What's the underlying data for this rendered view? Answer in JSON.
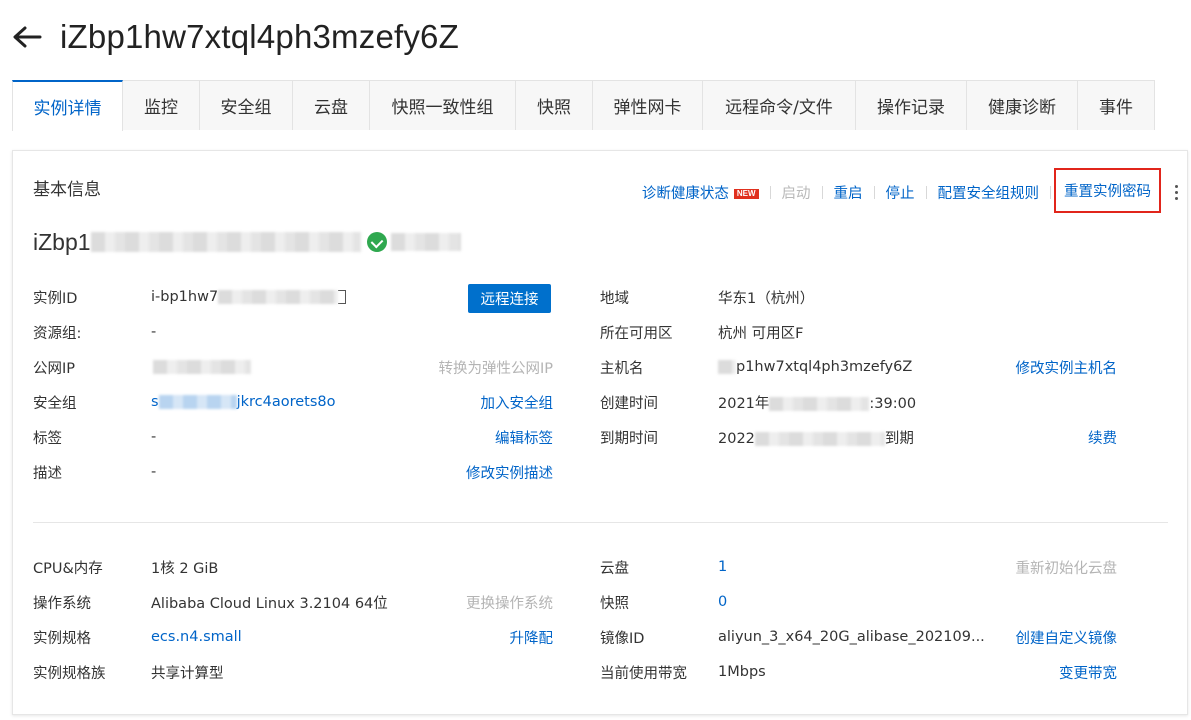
{
  "header": {
    "back_icon": "arrow-left-icon",
    "title": "iZbp1hw7xtql4ph3mzefy6Z"
  },
  "tabs": [
    {
      "label": "实例详情",
      "active": true
    },
    {
      "label": "监控"
    },
    {
      "label": "安全组"
    },
    {
      "label": "云盘"
    },
    {
      "label": "快照一致性组"
    },
    {
      "label": "快照"
    },
    {
      "label": "弹性网卡"
    },
    {
      "label": "远程命令/文件"
    },
    {
      "label": "操作记录"
    },
    {
      "label": "健康诊断"
    },
    {
      "label": "事件"
    }
  ],
  "basic": {
    "section_title": "基本信息",
    "actions": {
      "diagnose": "诊断健康状态",
      "new_badge": "NEW",
      "start": "启动",
      "restart": "重启",
      "stop": "停止",
      "config_sg_rules": "配置安全组规则",
      "reset_password": "重置实例密码",
      "more_icon": "more-vertical-icon"
    },
    "instance_name_visible": "iZbp1",
    "status_icon": "running-status-icon",
    "status_color": "#2fa84f",
    "left": {
      "instance_id_label": "实例ID",
      "instance_id_value": "i-bp1hw7",
      "connect_button": "远程连接",
      "resource_group_label": "资源组:",
      "resource_group_value": "-",
      "public_ip_label": "公网IP",
      "public_ip_action": "转换为弹性公网IP",
      "security_group_label": "安全组",
      "security_group_prefix": "s",
      "security_group_suffix": "jkrc4aorets8o",
      "security_group_action": "加入安全组",
      "tag_label": "标签",
      "tag_value": "-",
      "tag_action": "编辑标签",
      "desc_label": "描述",
      "desc_value": "-",
      "desc_action": "修改实例描述"
    },
    "right": {
      "region_label": "地域",
      "region_value": "华东1（杭州）",
      "zone_label": "所在可用区",
      "zone_value": "杭州 可用区F",
      "hostname_label": "主机名",
      "hostname_value": "p1hw7xtql4ph3mzefy6Z",
      "hostname_action": "修改实例主机名",
      "created_label": "创建时间",
      "created_prefix": "2021年",
      "created_suffix": ":39:00",
      "expire_label": "到期时间",
      "expire_prefix": "2022",
      "expire_suffix": "到期",
      "expire_action": "续费"
    }
  },
  "config": {
    "left": {
      "cpu_label": "CPU&内存",
      "cpu_value": "1核 2 GiB",
      "os_label": "操作系统",
      "os_value": "Alibaba Cloud Linux 3.2104 64位",
      "os_action": "更换操作系统",
      "spec_label": "实例规格",
      "spec_value": "ecs.n4.small",
      "spec_action": "升降配",
      "family_label": "实例规格族",
      "family_value": "共享计算型"
    },
    "right": {
      "disk_label": "云盘",
      "disk_value": "1",
      "disk_action": "重新初始化云盘",
      "snapshot_label": "快照",
      "snapshot_value": "0",
      "image_label": "镜像ID",
      "image_value": "aliyun_3_x64_20G_alibase_202109...",
      "image_action": "创建自定义镜像",
      "bandwidth_label": "当前使用带宽",
      "bandwidth_value": "1Mbps",
      "bandwidth_action": "变更带宽"
    }
  },
  "colors": {
    "link": "#0064c8",
    "primary_button": "#0070cc",
    "highlight": "#e1251b",
    "disabled": "#b9b9b9"
  }
}
